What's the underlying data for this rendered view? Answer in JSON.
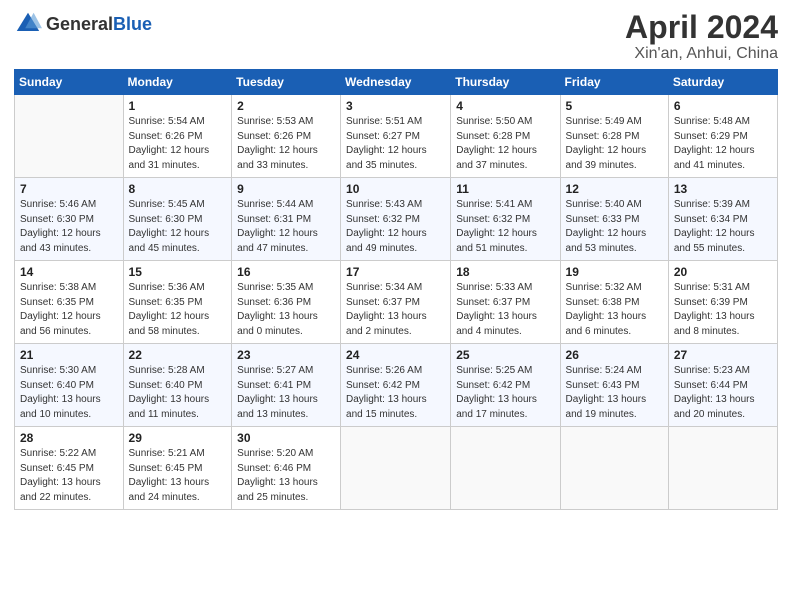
{
  "header": {
    "logo_general": "General",
    "logo_blue": "Blue",
    "title": "April 2024",
    "subtitle": "Xin'an, Anhui, China"
  },
  "days_of_week": [
    "Sunday",
    "Monday",
    "Tuesday",
    "Wednesday",
    "Thursday",
    "Friday",
    "Saturday"
  ],
  "weeks": [
    [
      {
        "day": "",
        "detail": ""
      },
      {
        "day": "1",
        "detail": "Sunrise: 5:54 AM\nSunset: 6:26 PM\nDaylight: 12 hours\nand 31 minutes."
      },
      {
        "day": "2",
        "detail": "Sunrise: 5:53 AM\nSunset: 6:26 PM\nDaylight: 12 hours\nand 33 minutes."
      },
      {
        "day": "3",
        "detail": "Sunrise: 5:51 AM\nSunset: 6:27 PM\nDaylight: 12 hours\nand 35 minutes."
      },
      {
        "day": "4",
        "detail": "Sunrise: 5:50 AM\nSunset: 6:28 PM\nDaylight: 12 hours\nand 37 minutes."
      },
      {
        "day": "5",
        "detail": "Sunrise: 5:49 AM\nSunset: 6:28 PM\nDaylight: 12 hours\nand 39 minutes."
      },
      {
        "day": "6",
        "detail": "Sunrise: 5:48 AM\nSunset: 6:29 PM\nDaylight: 12 hours\nand 41 minutes."
      }
    ],
    [
      {
        "day": "7",
        "detail": "Sunrise: 5:46 AM\nSunset: 6:30 PM\nDaylight: 12 hours\nand 43 minutes."
      },
      {
        "day": "8",
        "detail": "Sunrise: 5:45 AM\nSunset: 6:30 PM\nDaylight: 12 hours\nand 45 minutes."
      },
      {
        "day": "9",
        "detail": "Sunrise: 5:44 AM\nSunset: 6:31 PM\nDaylight: 12 hours\nand 47 minutes."
      },
      {
        "day": "10",
        "detail": "Sunrise: 5:43 AM\nSunset: 6:32 PM\nDaylight: 12 hours\nand 49 minutes."
      },
      {
        "day": "11",
        "detail": "Sunrise: 5:41 AM\nSunset: 6:32 PM\nDaylight: 12 hours\nand 51 minutes."
      },
      {
        "day": "12",
        "detail": "Sunrise: 5:40 AM\nSunset: 6:33 PM\nDaylight: 12 hours\nand 53 minutes."
      },
      {
        "day": "13",
        "detail": "Sunrise: 5:39 AM\nSunset: 6:34 PM\nDaylight: 12 hours\nand 55 minutes."
      }
    ],
    [
      {
        "day": "14",
        "detail": "Sunrise: 5:38 AM\nSunset: 6:35 PM\nDaylight: 12 hours\nand 56 minutes."
      },
      {
        "day": "15",
        "detail": "Sunrise: 5:36 AM\nSunset: 6:35 PM\nDaylight: 12 hours\nand 58 minutes."
      },
      {
        "day": "16",
        "detail": "Sunrise: 5:35 AM\nSunset: 6:36 PM\nDaylight: 13 hours\nand 0 minutes."
      },
      {
        "day": "17",
        "detail": "Sunrise: 5:34 AM\nSunset: 6:37 PM\nDaylight: 13 hours\nand 2 minutes."
      },
      {
        "day": "18",
        "detail": "Sunrise: 5:33 AM\nSunset: 6:37 PM\nDaylight: 13 hours\nand 4 minutes."
      },
      {
        "day": "19",
        "detail": "Sunrise: 5:32 AM\nSunset: 6:38 PM\nDaylight: 13 hours\nand 6 minutes."
      },
      {
        "day": "20",
        "detail": "Sunrise: 5:31 AM\nSunset: 6:39 PM\nDaylight: 13 hours\nand 8 minutes."
      }
    ],
    [
      {
        "day": "21",
        "detail": "Sunrise: 5:30 AM\nSunset: 6:40 PM\nDaylight: 13 hours\nand 10 minutes."
      },
      {
        "day": "22",
        "detail": "Sunrise: 5:28 AM\nSunset: 6:40 PM\nDaylight: 13 hours\nand 11 minutes."
      },
      {
        "day": "23",
        "detail": "Sunrise: 5:27 AM\nSunset: 6:41 PM\nDaylight: 13 hours\nand 13 minutes."
      },
      {
        "day": "24",
        "detail": "Sunrise: 5:26 AM\nSunset: 6:42 PM\nDaylight: 13 hours\nand 15 minutes."
      },
      {
        "day": "25",
        "detail": "Sunrise: 5:25 AM\nSunset: 6:42 PM\nDaylight: 13 hours\nand 17 minutes."
      },
      {
        "day": "26",
        "detail": "Sunrise: 5:24 AM\nSunset: 6:43 PM\nDaylight: 13 hours\nand 19 minutes."
      },
      {
        "day": "27",
        "detail": "Sunrise: 5:23 AM\nSunset: 6:44 PM\nDaylight: 13 hours\nand 20 minutes."
      }
    ],
    [
      {
        "day": "28",
        "detail": "Sunrise: 5:22 AM\nSunset: 6:45 PM\nDaylight: 13 hours\nand 22 minutes."
      },
      {
        "day": "29",
        "detail": "Sunrise: 5:21 AM\nSunset: 6:45 PM\nDaylight: 13 hours\nand 24 minutes."
      },
      {
        "day": "30",
        "detail": "Sunrise: 5:20 AM\nSunset: 6:46 PM\nDaylight: 13 hours\nand 25 minutes."
      },
      {
        "day": "",
        "detail": ""
      },
      {
        "day": "",
        "detail": ""
      },
      {
        "day": "",
        "detail": ""
      },
      {
        "day": "",
        "detail": ""
      }
    ]
  ]
}
